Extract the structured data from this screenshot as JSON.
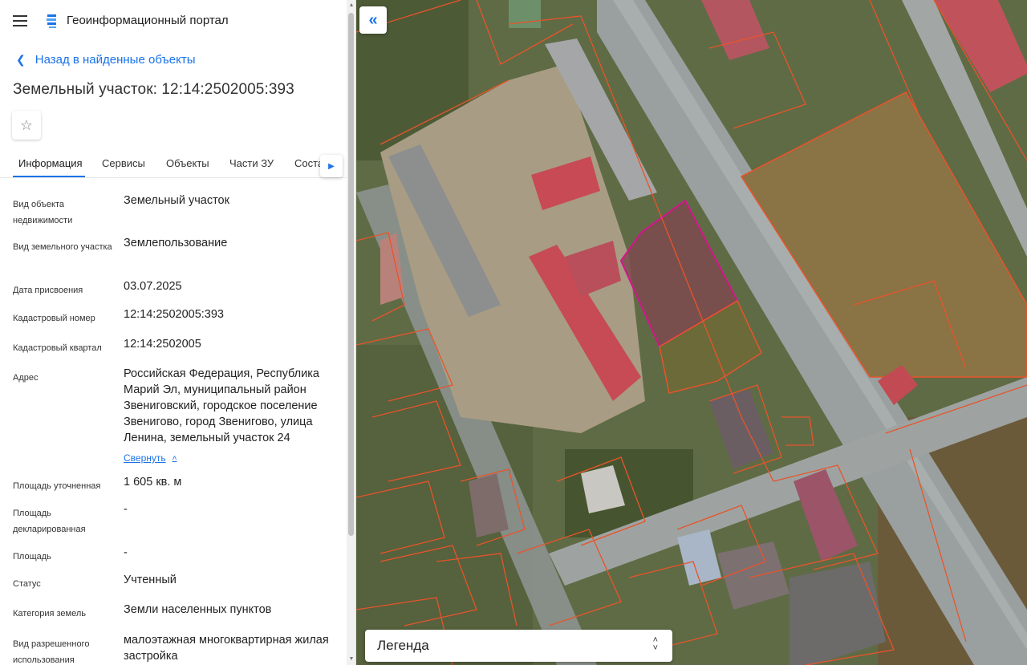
{
  "header": {
    "app_title": "Геоинформационный портал"
  },
  "nav": {
    "back_label": "Назад в найденные объекты"
  },
  "parcel": {
    "title": "Земельный участок: 12:14:2502005:393"
  },
  "tabs": [
    {
      "label": "Информация"
    },
    {
      "label": "Сервисы"
    },
    {
      "label": "Объекты"
    },
    {
      "label": "Части ЗУ"
    },
    {
      "label": "Соста"
    }
  ],
  "info": [
    {
      "label": "Вид объекта недвижимости",
      "value": "Земельный участок"
    },
    {
      "label": "Вид земельного участка",
      "value": "Землепользование"
    },
    {
      "label": "Дата присвоения",
      "value": "03.07.2025"
    },
    {
      "label": "Кадастровый номер",
      "value": "12:14:2502005:393"
    },
    {
      "label": "Кадастровый квартал",
      "value": "12:14:2502005"
    },
    {
      "label": "Адрес",
      "value": "Российская Федерация, Республика Марий Эл, муниципальный район Звениговский, городское поселение Звенигово, город Звенигово, улица Ленина, земельный участок 24"
    },
    {
      "label": "Площадь уточненная",
      "value": "1 605 кв. м"
    },
    {
      "label": "Площадь декларированная",
      "value": "-"
    },
    {
      "label": "Площадь",
      "value": "-"
    },
    {
      "label": "Статус",
      "value": "Учтенный"
    },
    {
      "label": "Категория земель",
      "value": "Земли населенных пунктов"
    },
    {
      "label": "Вид разрешенного использования",
      "value": "малоэтажная многоквартирная жилая застройка"
    }
  ],
  "address_toggle": {
    "label": "Свернуть"
  },
  "map": {
    "legend_label": "Легенда"
  },
  "colors": {
    "accent": "#1a73e8",
    "parcel_border": "#e8542a",
    "selected_parcel": "#d6148c"
  }
}
